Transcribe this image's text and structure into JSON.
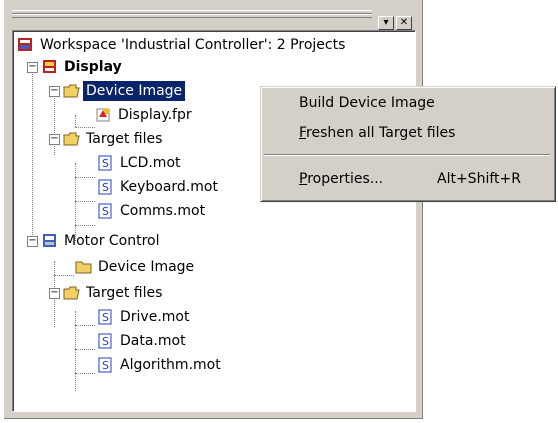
{
  "workspace": {
    "root_label": "Workspace 'Industrial Controller': 2 Projects",
    "tree": [
      {
        "label": "Display",
        "bold": true
      },
      {
        "label": "Device Image",
        "selected": true
      },
      {
        "label": "Display.fpr"
      },
      {
        "label": "Target files"
      },
      {
        "label": "LCD.mot"
      },
      {
        "label": "Keyboard.mot"
      },
      {
        "label": "Comms.mot"
      },
      {
        "label": "Motor Control"
      },
      {
        "label": "Device Image"
      },
      {
        "label": "Target files"
      },
      {
        "label": "Drive.mot"
      },
      {
        "label": "Data.mot"
      },
      {
        "label": "Algorithm.mot"
      }
    ],
    "buttons": {
      "pin": "▾",
      "close": "✕"
    }
  },
  "context_menu": {
    "items": [
      {
        "label": "Build Device Image",
        "shortcut": ""
      },
      {
        "label_prefix": "",
        "mnemonic": "F",
        "label_suffix": "reshen all Target files",
        "shortcut": ""
      },
      {
        "label_prefix": "",
        "mnemonic": "P",
        "label_suffix": "roperties...",
        "shortcut": "Alt+Shift+R"
      }
    ]
  },
  "colors": {
    "selection": "#0a246a",
    "panel": "#d4d0c8",
    "folder": "#f0d060"
  }
}
